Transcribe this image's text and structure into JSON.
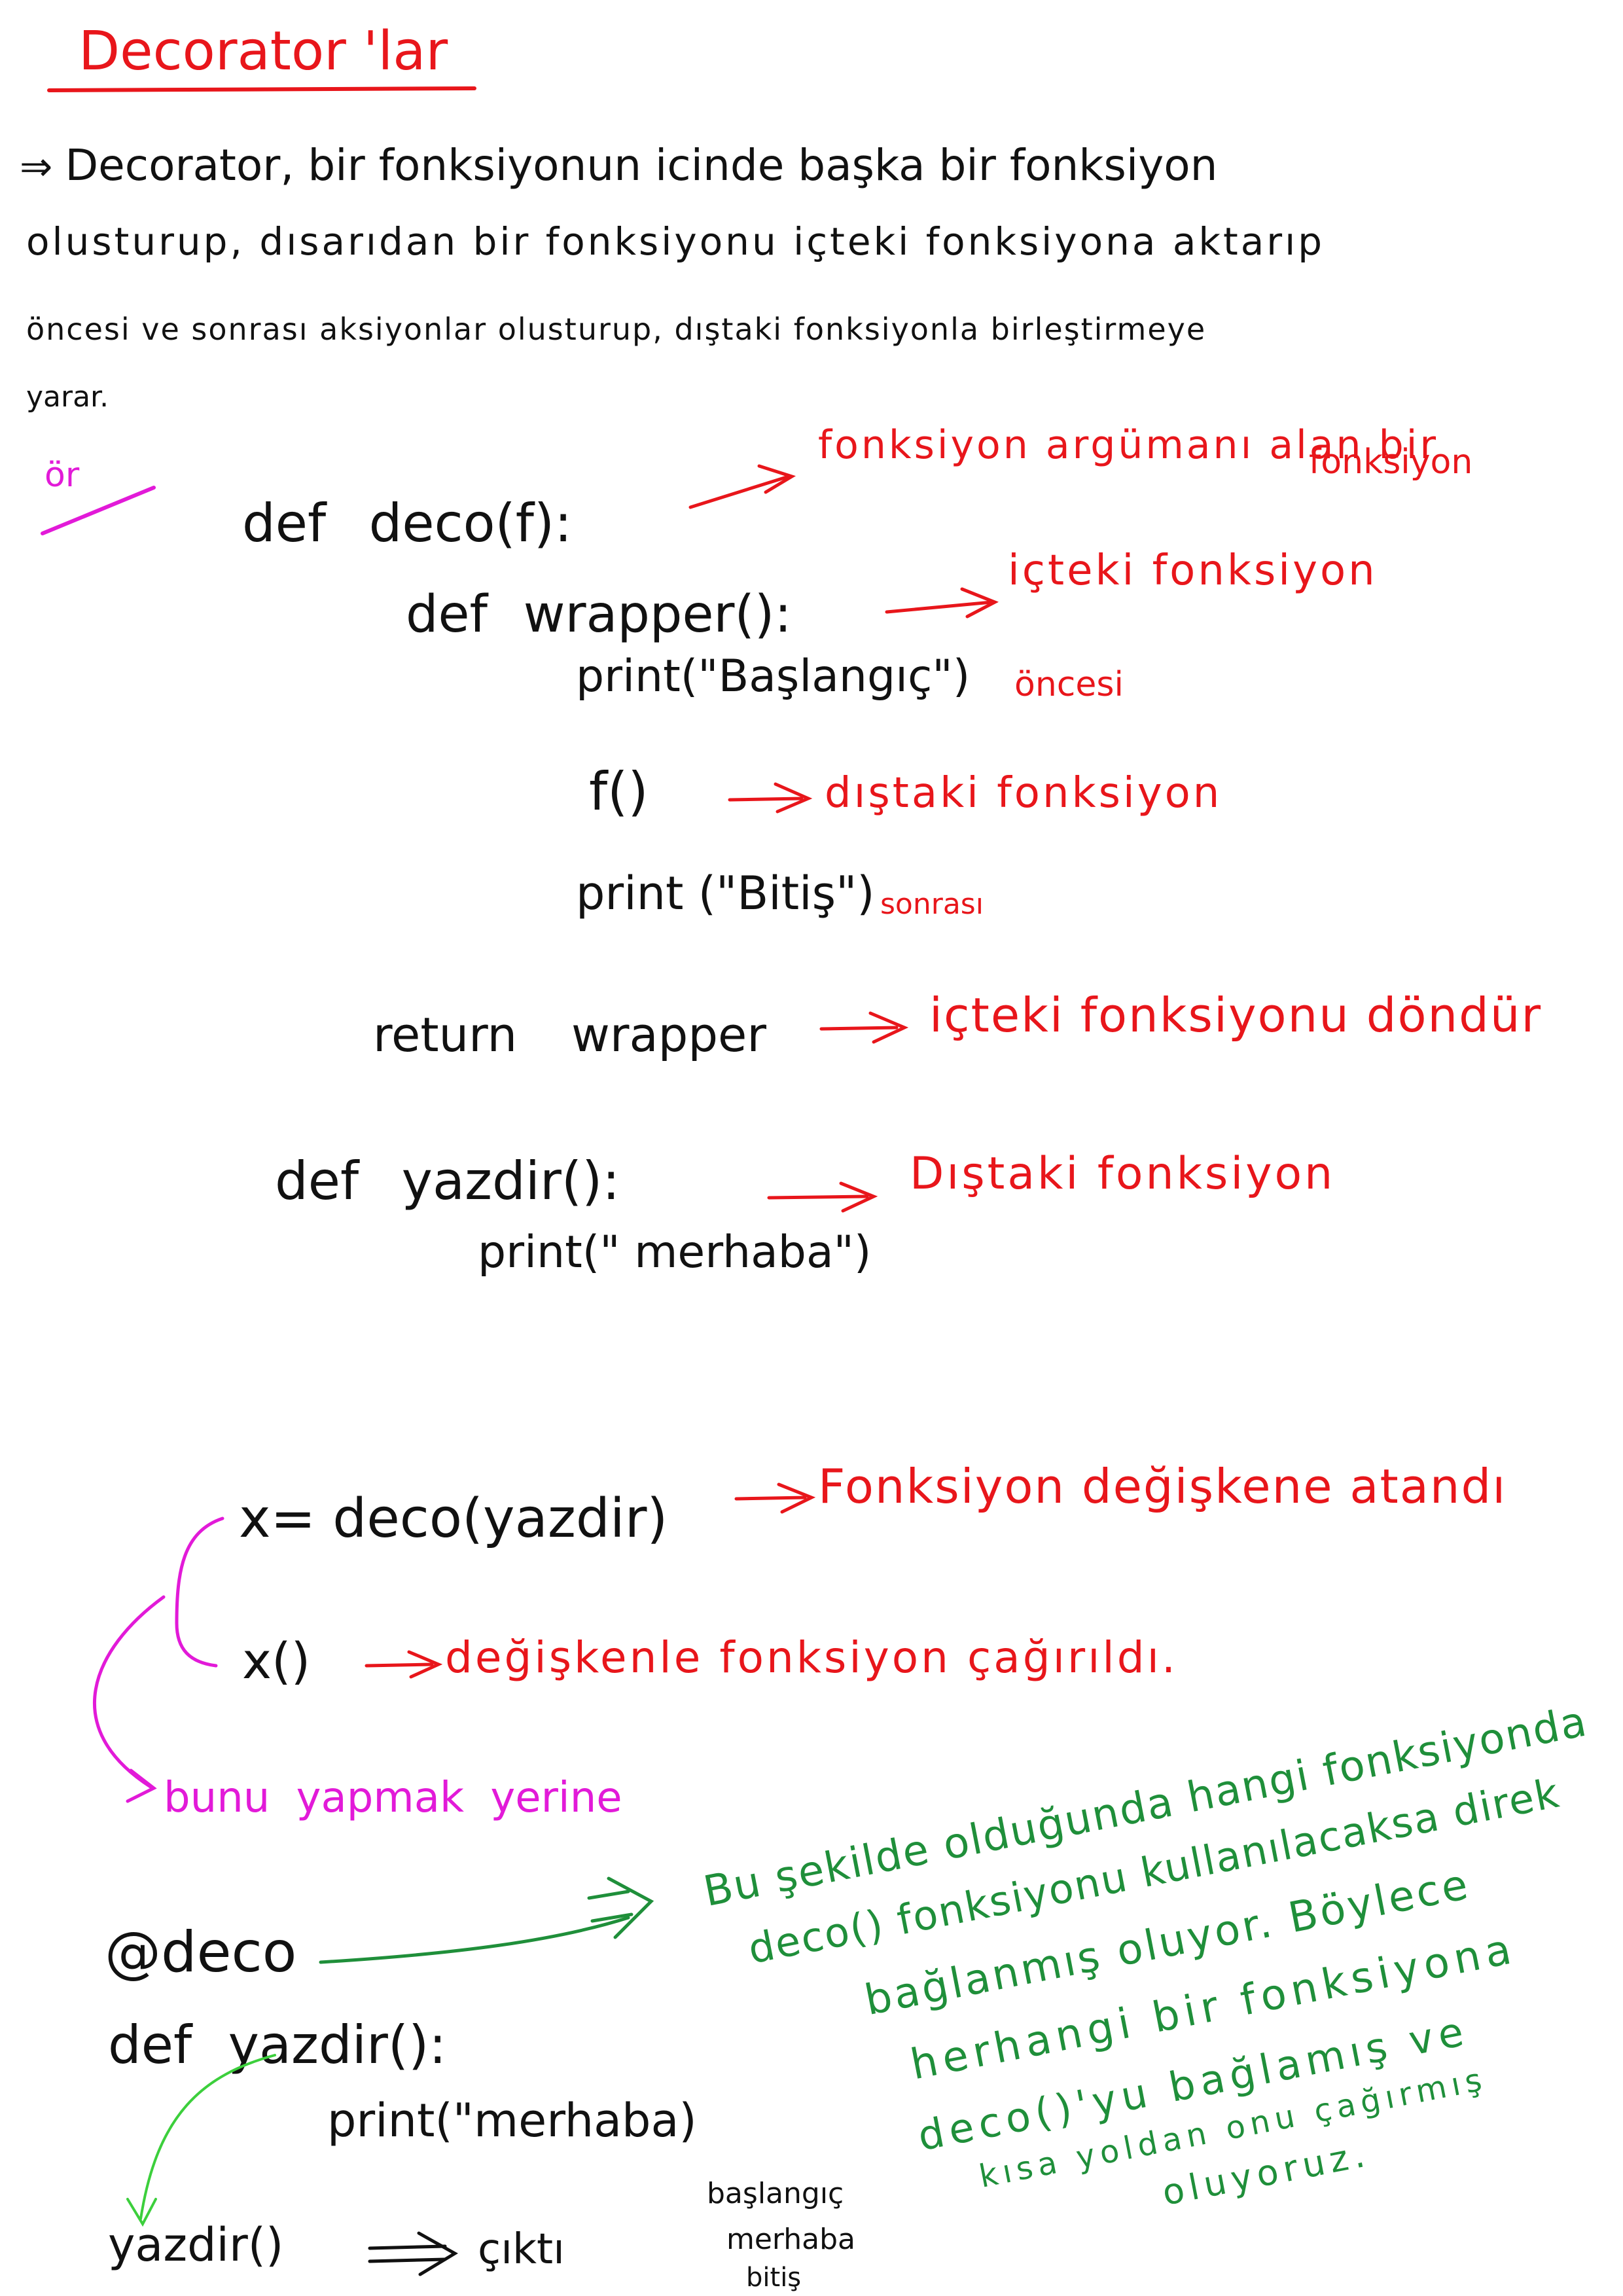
{
  "title": "Decorator 'lar",
  "intro": [
    "Decorator, bir fonksiyonun icinde başka bir fonksiyon",
    "olusturup, dısarıdan bir fonksiyonu içteki fonksiyona aktarıp",
    "öncesi ve sonrası aksiyonlar olusturup, dıştaki fonksiyonla birleştirmeye",
    "yarar."
  ],
  "ornek_label": "ör",
  "code1": {
    "line_def_deco": "def deco(f):",
    "line_def_wrapper": "def wrapper():",
    "line_print_baslangic": "print(\"Başlangıç\")",
    "line_f_call": "f()",
    "line_print_bitis": "print (\"Bitiş\")",
    "line_return": "return wrapper",
    "line_def_yazdir": "def yazdir():",
    "line_print_merhaba": "print(\" merhaba\")"
  },
  "notes1": {
    "arg_func_1": "fonksiyon argümanı alan bir",
    "arg_func_2": "fonksiyon",
    "inner_func": "içteki fonksiyon",
    "before": "öncesi",
    "outer_func": "dıştaki fonksiyon",
    "after": "sonrası",
    "return_inner": "içteki fonksiyonu döndür",
    "outer_func2": "Dıştaki fonksiyon"
  },
  "code2": {
    "assign": "x= deco(yazdir)",
    "call": "x()"
  },
  "notes2": {
    "assigned": "Fonksiyon değişkene atandı",
    "called": "değişkenle fonksiyon çağırıldı."
  },
  "instead": "bunu yapmak yerine",
  "code3": {
    "decorator": "@deco",
    "def_yazdir": "def yazdir():",
    "print_merhaba": "print(\"merhaba)",
    "call": "yazdir()",
    "arrow_label": "çıktı",
    "output": [
      "başlangıç",
      "merhaba",
      "bitiş"
    ]
  },
  "green_note": [
    "Bu şekilde olduğunda hangi fonksiyonda",
    "deco() fonksiyonu kullanılacaksa direk",
    "bağlanmış oluyor. Böylece",
    "herhangi bir fonksiyona",
    "deco()'yu bağlamış ve",
    "kısa yoldan onu çağırmış",
    "oluyoruz."
  ],
  "colors": {
    "ink": "#111111",
    "red_note": "#e8161b",
    "green_note": "#1f8f3a",
    "magenta": "#e21ad8",
    "light_green_arrow": "#3ccf3c"
  }
}
